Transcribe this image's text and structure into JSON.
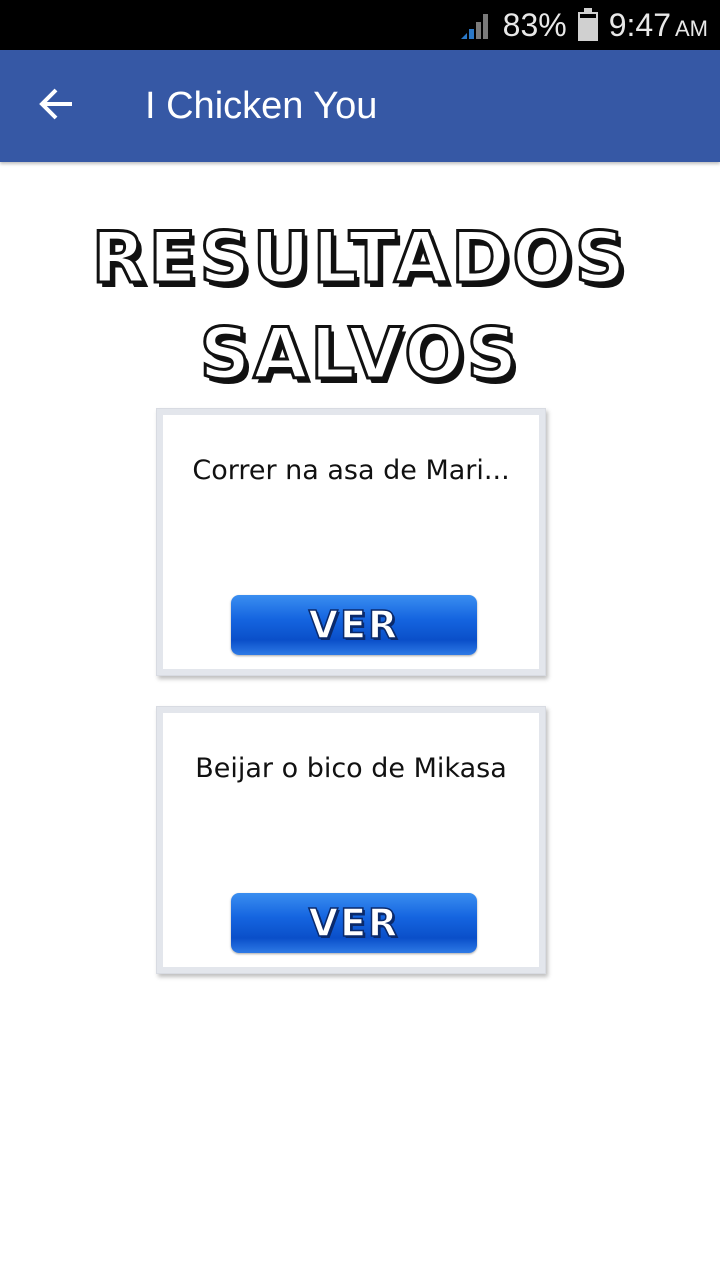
{
  "status_bar": {
    "battery_percent": "83%",
    "time": "9:47",
    "time_suffix": "AM",
    "icons": [
      "signal-icon",
      "battery-icon"
    ]
  },
  "app_bar": {
    "title": "I Chicken You",
    "back_icon": "arrow-left-icon",
    "color": "#3658a5"
  },
  "heading": {
    "line1": "RESULTADOS",
    "line2": "SALVOS"
  },
  "cards": [
    {
      "title": "Correr na asa de Mari...",
      "button_label": "VER"
    },
    {
      "title": "Beijar o bico de Mikasa",
      "button_label": "VER"
    }
  ],
  "colors": {
    "button_blue": "#1565e0",
    "status_bar": "#000000"
  }
}
